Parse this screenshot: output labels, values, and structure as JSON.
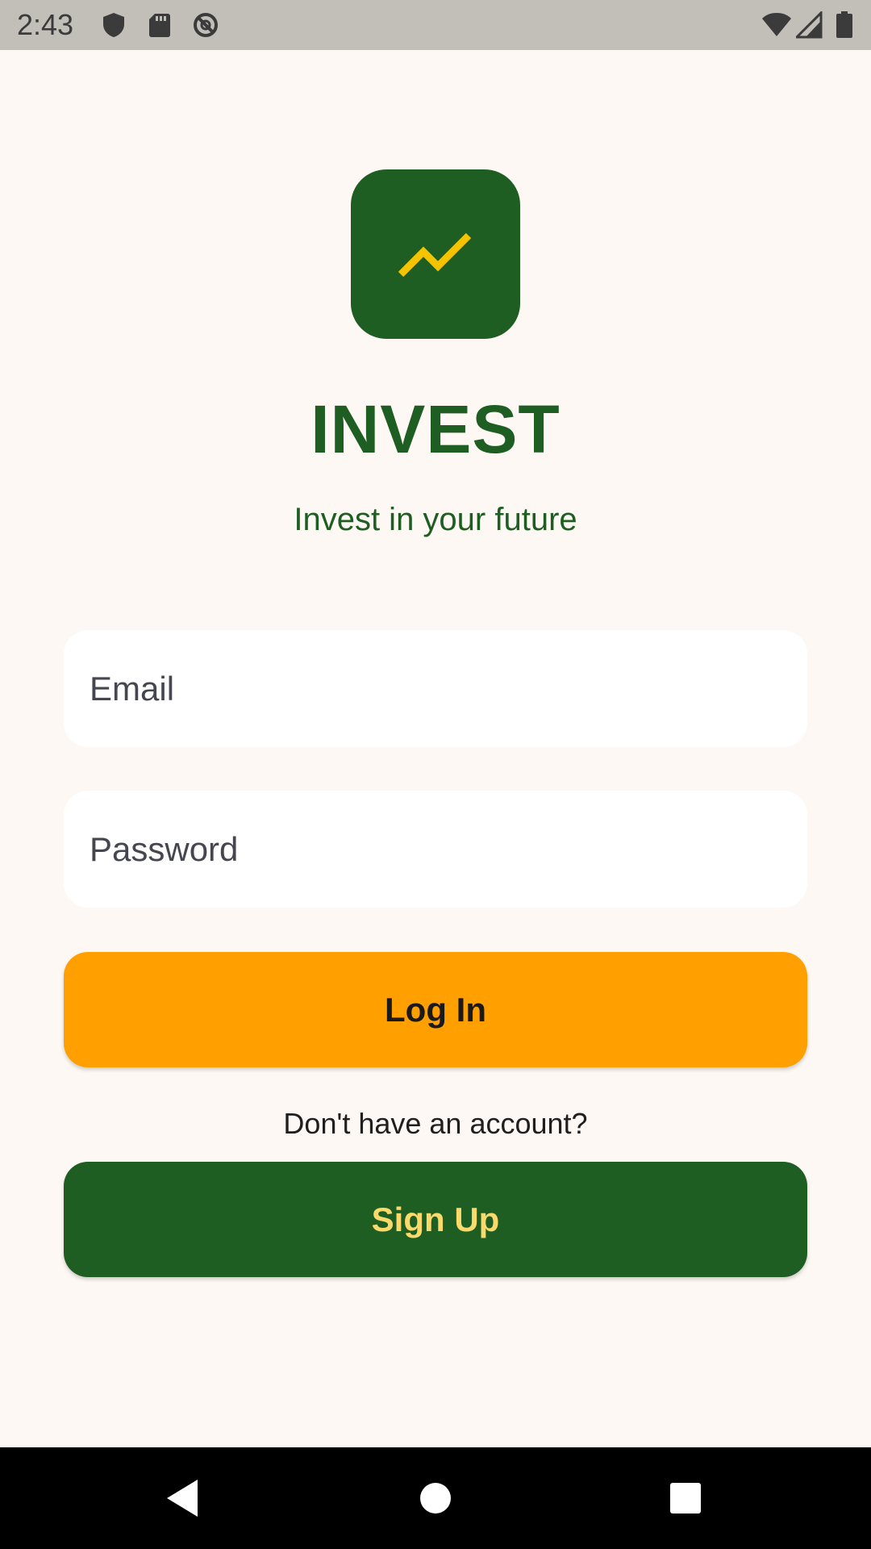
{
  "status_bar": {
    "time": "2:43",
    "left_icons": [
      "shield-icon",
      "sd-card-icon",
      "no-sync-icon"
    ],
    "right_icons": [
      "wifi-icon",
      "signal-icon",
      "battery-icon"
    ]
  },
  "logo": {
    "icon": "trending-up-icon",
    "background_color": "#1e5e22",
    "icon_color": "#f5c400"
  },
  "header": {
    "title": "INVEST",
    "tagline": "Invest in your future"
  },
  "form": {
    "email_placeholder": "Email",
    "email_value": "",
    "password_placeholder": "Password",
    "password_value": ""
  },
  "actions": {
    "login_label": "Log In",
    "signup_prompt": "Don't have an account?",
    "signup_label": "Sign Up"
  },
  "colors": {
    "primary_green": "#1e5e22",
    "accent_orange": "#ffa000",
    "signup_text": "#fbd96a",
    "background": "#fdf8f3"
  },
  "nav_bar": {
    "buttons": [
      "back-icon",
      "home-icon",
      "recents-icon"
    ]
  }
}
